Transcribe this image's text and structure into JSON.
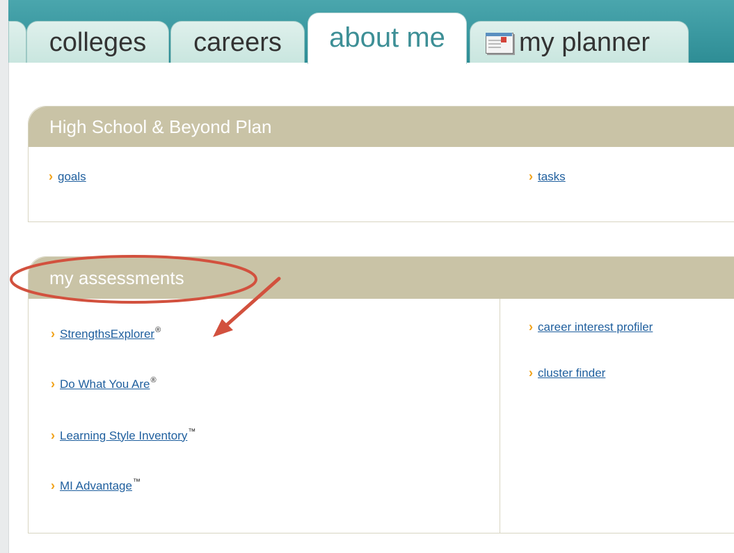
{
  "tabs": {
    "colleges": "colleges",
    "careers": "careers",
    "about_me": "about me",
    "my_planner": "my planner"
  },
  "hsbp": {
    "title": "High School & Beyond Plan",
    "links": [
      {
        "label": "goals"
      },
      {
        "label": "tasks"
      }
    ]
  },
  "assessments": {
    "title": "my assessments",
    "left_links": [
      {
        "label": "StrengthsExplorer",
        "mark": "®"
      },
      {
        "label": "Do What You Are",
        "mark": "®"
      },
      {
        "label": "Learning Style Inventory",
        "mark": "™"
      },
      {
        "label": "MI Advantage",
        "mark": "™"
      }
    ],
    "right_links": [
      {
        "label": "career interest profiler"
      },
      {
        "label": "cluster finder"
      }
    ]
  },
  "colors": {
    "tab_bar": "#3a98a0",
    "panel_header": "#c9c3a6",
    "link": "#1f5f9e",
    "chevron": "#f0a21a",
    "annotation": "#d2513e"
  },
  "icons": {
    "planner": "planner-calendar-icon",
    "chevron": "chevron-right-icon"
  }
}
